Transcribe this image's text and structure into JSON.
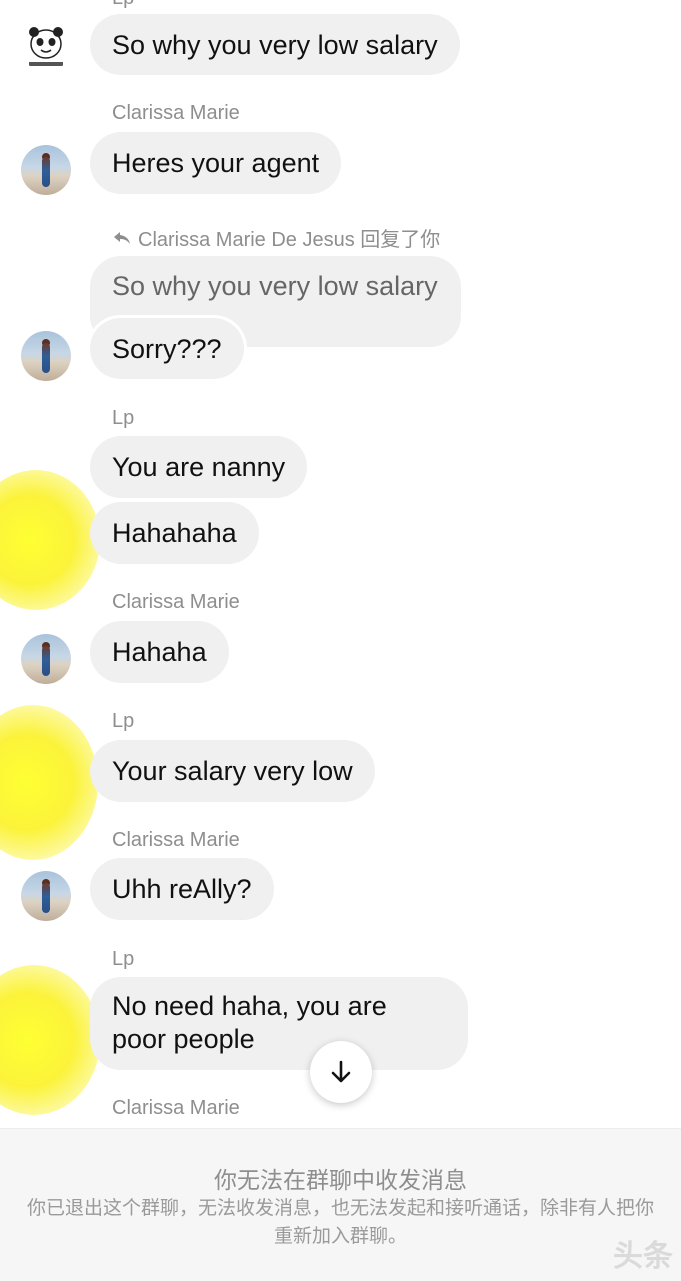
{
  "messages": [
    {
      "sender": "",
      "text": "So why you very low salary"
    },
    {
      "sender": "Clarissa Marie",
      "text": "Heres your agent"
    },
    {
      "reply_header": "Clarissa Marie De Jesus 回复了你",
      "quoted_text": "So why you very low salary",
      "text": "Sorry???"
    },
    {
      "sender": "Lp",
      "text": "You are nanny"
    },
    {
      "text": "Hahahaha"
    },
    {
      "sender": "Clarissa Marie",
      "text": "Hahaha"
    },
    {
      "sender": "Lp",
      "text": "Your salary very low"
    },
    {
      "sender": "Clarissa Marie",
      "text": "Uhh reAlly?"
    },
    {
      "sender": "Lp",
      "text": "No need haha, you are poor people"
    },
    {
      "sender": "Clarissa Marie",
      "text": ""
    }
  ],
  "top_sender_partial": "Lp",
  "scroll_down_icon": "arrow-down-icon",
  "footer": {
    "title": "你无法在群聊中收发消息",
    "description": "你已退出这个群聊，无法收发消息，也无法发起和接听通话，除非有人把你重新加入群聊。"
  },
  "watermark": "头条"
}
